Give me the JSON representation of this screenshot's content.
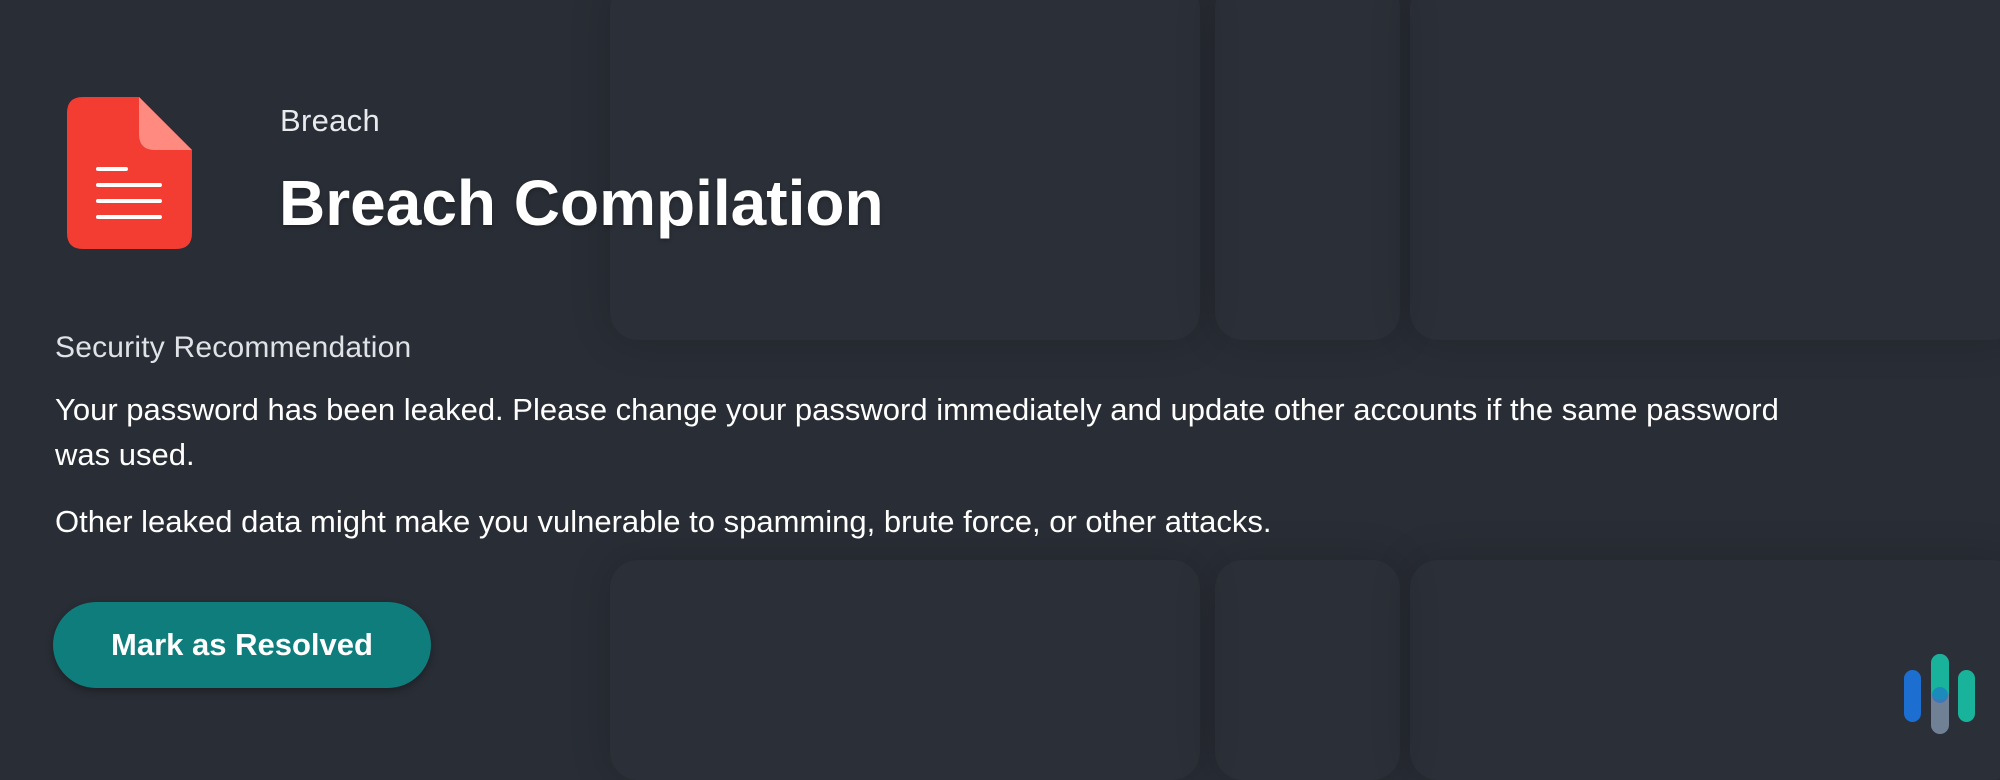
{
  "breach": {
    "category": "Breach",
    "title": "Breach Compilation"
  },
  "recommendation": {
    "label": "Security Recommendation",
    "paragraph_1": "Your password has been leaked. Please change your password immediately and update other accounts if the same password was used.",
    "paragraph_2": "Other leaked data might make you vulnerable to spamming, brute force, or other attacks."
  },
  "actions": {
    "resolve_label": "Mark as Resolved"
  },
  "icons": {
    "document": "document-icon",
    "brand": "brand-logo-icon"
  },
  "colors": {
    "background": "#292d35",
    "document_red": "#f33d33",
    "document_fold": "#ff8a80",
    "button_teal": "#0f7d7b",
    "brand_blue": "#1c6fd1",
    "brand_teal": "#19b39b"
  }
}
